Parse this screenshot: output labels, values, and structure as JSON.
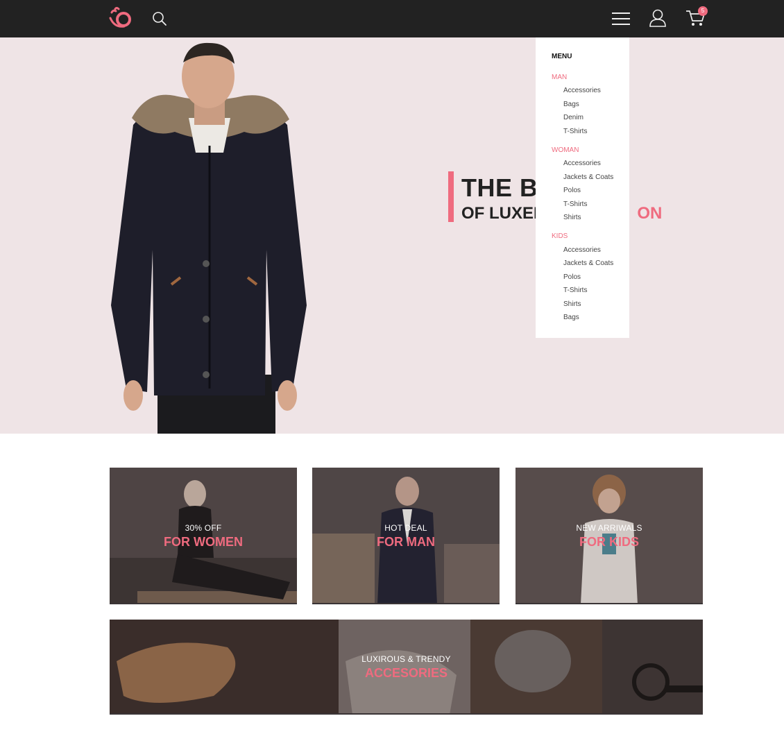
{
  "header": {
    "logo_icon": "logo-swirl-icon",
    "search_icon": "search-icon",
    "menu_icon": "hamburger-icon",
    "user_icon": "user-icon",
    "cart_icon": "cart-icon",
    "cart_count": "5"
  },
  "hero": {
    "title": "THE BI",
    "subtitle_dark": "OF LUXER",
    "subtitle_accent": "ON"
  },
  "menu": {
    "title": "MENU",
    "sections": [
      {
        "category": "MAN",
        "items": [
          "Accessories",
          "Bags",
          "Denim",
          "T-Shirts"
        ]
      },
      {
        "category": "WOMAN",
        "items": [
          "Accessories",
          "Jackets & Coats",
          "Polos",
          "T-Shirts",
          "Shirts"
        ]
      },
      {
        "category": "KIDS",
        "items": [
          "Accessories",
          "Jackets & Coats",
          "Polos",
          "T-Shirts",
          "Shirts",
          "Bags"
        ]
      }
    ]
  },
  "tiles": [
    {
      "small": "30% OFF",
      "big": "FOR WOMEN"
    },
    {
      "small": "HOT DEAL",
      "big": "FOR MAN"
    },
    {
      "small": "NEW ARRIWALS",
      "big": "FOR KIDS"
    },
    {
      "small": "LUXIROUS & TRENDY",
      "big": "ACCESORIES"
    }
  ],
  "colors": {
    "accent": "#ef6b7f",
    "topbar": "#222222",
    "hero_bg": "#efe4e6"
  }
}
